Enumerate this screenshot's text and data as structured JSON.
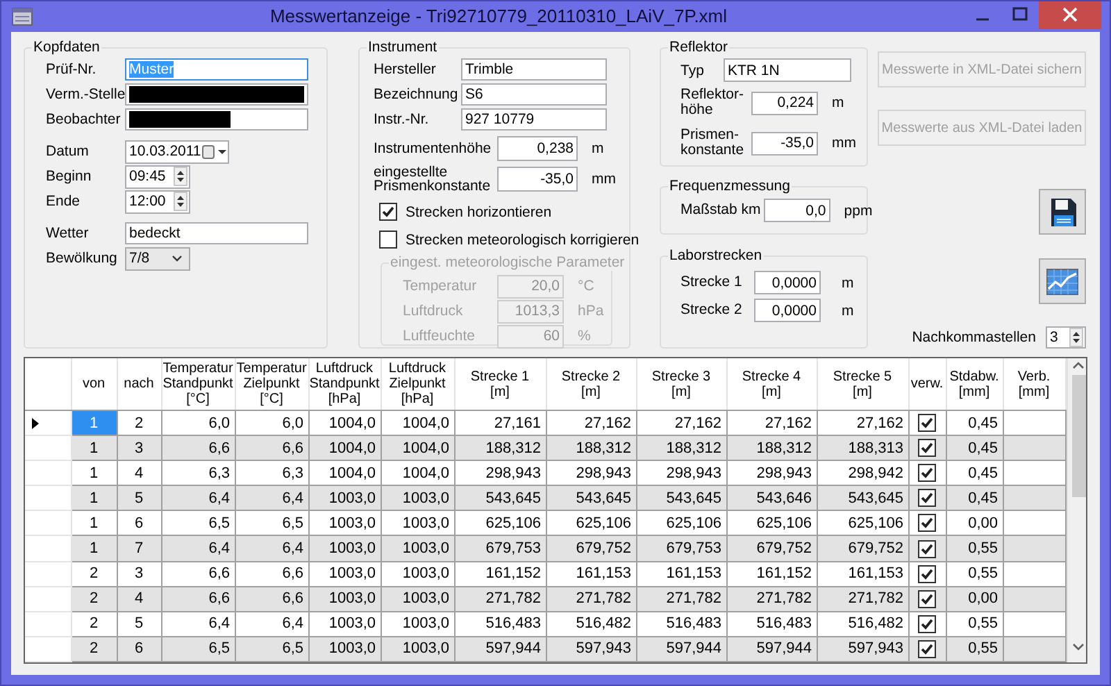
{
  "window": {
    "title": "Messwertanzeige - Tri92710779_20110310_LAiV_7P.xml"
  },
  "kopfdaten": {
    "title": "Kopfdaten",
    "sections": [
      {
        "fields": [
          {
            "label": "Prüf-Nr.",
            "kind": "text",
            "value": "Muster",
            "selected": true
          },
          {
            "label": "Verm.-Stelle",
            "kind": "redacted_full"
          },
          {
            "label": "Beobachter",
            "kind": "redacted_partial"
          }
        ]
      },
      {
        "fields": [
          {
            "label": "Datum",
            "kind": "date",
            "value": "10.03.2011"
          },
          {
            "label": "Beginn",
            "kind": "time",
            "value": "09:45"
          },
          {
            "label": "Ende",
            "kind": "time",
            "value": "12:00"
          }
        ]
      },
      {
        "fields": [
          {
            "label": "Wetter",
            "kind": "text",
            "value": "bedeckt",
            "selected": false
          },
          {
            "label": "Bewölkung",
            "kind": "combo",
            "value": "7/8"
          }
        ]
      }
    ]
  },
  "instrument": {
    "title": "Instrument",
    "fields": [
      {
        "label": "Hersteller",
        "value": "Trimble"
      },
      {
        "label": "Bezeichnung",
        "value": "S6"
      },
      {
        "label": "Instr.-Nr.",
        "value": "927 10779"
      }
    ],
    "numbers": [
      {
        "label": "Instrumentenhöhe",
        "value": "0,238",
        "unit": "m"
      },
      {
        "label": "eingestellte Prismenkonstante",
        "value": "-35,0",
        "unit": "mm"
      }
    ],
    "checkboxes": [
      {
        "label": "Strecken horizontieren",
        "checked": true
      },
      {
        "label": "Strecken meteorologisch korrigieren",
        "checked": false
      }
    ],
    "meteo": {
      "title": "eingest. meteorologische Parameter",
      "disabled": true,
      "fields": [
        {
          "label": "Temperatur",
          "value": "20,0",
          "unit": "°C"
        },
        {
          "label": "Luftdruck",
          "value": "1013,3",
          "unit": "hPa"
        },
        {
          "label": "Luftfeuchte",
          "value": "60",
          "unit": "%"
        }
      ]
    }
  },
  "reflektor": {
    "title": "Reflektor",
    "type_label": "Typ",
    "type_value": "KTR 1N",
    "numbers": [
      {
        "label": "Reflektor-höhe",
        "value": "0,224",
        "unit": "m"
      },
      {
        "label": "Prismen-konstante",
        "value": "-35,0",
        "unit": "mm"
      }
    ]
  },
  "frequenzmessung": {
    "title": "Frequenzmessung",
    "fields": [
      {
        "label": "Maßstab km",
        "value": "0,0",
        "unit": "ppm"
      }
    ]
  },
  "laborstrecken": {
    "title": "Laborstrecken",
    "fields": [
      {
        "label": "Strecke 1",
        "value": "0,0000",
        "unit": "m"
      },
      {
        "label": "Strecke 2",
        "value": "0,0000",
        "unit": "m"
      }
    ]
  },
  "buttons": [
    {
      "label": "Messwerte in XML-Datei sichern",
      "disabled": true
    },
    {
      "label": "Messwerte aus XML-Datei laden",
      "disabled": true
    }
  ],
  "icon_buttons": [
    {
      "kind": "save"
    },
    {
      "kind": "chart"
    }
  ],
  "nachkommastellen": {
    "label": "Nachkommastellen",
    "value": "3"
  },
  "table": {
    "columns": [
      "von",
      "nach",
      "Temperatur\nStandpunkt\n[°C]",
      "Temperatur\nZielpunkt\n[°C]",
      "Luftdruck\nStandpunkt\n[hPa]",
      "Luftdruck\nZielpunkt\n[hPa]",
      "Strecke 1\n[m]",
      "Strecke 2\n[m]",
      "Strecke 3\n[m]",
      "Strecke 4\n[m]",
      "Strecke 5\n[m]",
      "verw.",
      "Stdabw.\n[mm]",
      "Verb.\n[mm]"
    ],
    "rows": [
      {
        "values": [
          "1",
          "2",
          "6,0",
          "6,0",
          "1004,0",
          "1004,0",
          "27,161",
          "27,162",
          "27,162",
          "27,162",
          "27,162"
        ],
        "verw": true,
        "stdabw": "0,45",
        "selected": true
      },
      {
        "values": [
          "1",
          "3",
          "6,6",
          "6,6",
          "1004,0",
          "1004,0",
          "188,312",
          "188,312",
          "188,312",
          "188,312",
          "188,313"
        ],
        "verw": true,
        "stdabw": "0,45",
        "selected": false
      },
      {
        "values": [
          "1",
          "4",
          "6,3",
          "6,3",
          "1004,0",
          "1004,0",
          "298,943",
          "298,943",
          "298,943",
          "298,943",
          "298,942"
        ],
        "verw": true,
        "stdabw": "0,45",
        "selected": false
      },
      {
        "values": [
          "1",
          "5",
          "6,4",
          "6,4",
          "1003,0",
          "1003,0",
          "543,645",
          "543,645",
          "543,645",
          "543,646",
          "543,645"
        ],
        "verw": true,
        "stdabw": "0,45",
        "selected": false
      },
      {
        "values": [
          "1",
          "6",
          "6,5",
          "6,5",
          "1003,0",
          "1003,0",
          "625,106",
          "625,106",
          "625,106",
          "625,106",
          "625,106"
        ],
        "verw": true,
        "stdabw": "0,00",
        "selected": false
      },
      {
        "values": [
          "1",
          "7",
          "6,4",
          "6,4",
          "1003,0",
          "1003,0",
          "679,753",
          "679,752",
          "679,753",
          "679,752",
          "679,752"
        ],
        "verw": true,
        "stdabw": "0,55",
        "selected": false
      },
      {
        "values": [
          "2",
          "3",
          "6,6",
          "6,6",
          "1003,0",
          "1003,0",
          "161,152",
          "161,153",
          "161,153",
          "161,152",
          "161,153"
        ],
        "verw": true,
        "stdabw": "0,55",
        "selected": false
      },
      {
        "values": [
          "2",
          "4",
          "6,6",
          "6,6",
          "1003,0",
          "1003,0",
          "271,782",
          "271,782",
          "271,782",
          "271,782",
          "271,782"
        ],
        "verw": true,
        "stdabw": "0,00",
        "selected": false
      },
      {
        "values": [
          "2",
          "5",
          "6,4",
          "6,4",
          "1003,0",
          "1003,0",
          "516,483",
          "516,482",
          "516,483",
          "516,483",
          "516,482"
        ],
        "verw": true,
        "stdabw": "0,55",
        "selected": false
      },
      {
        "values": [
          "2",
          "6",
          "6,5",
          "6,5",
          "1003,0",
          "1003,0",
          "597,944",
          "597,943",
          "597,944",
          "597,944",
          "597,943"
        ],
        "verw": true,
        "stdabw": "0,55",
        "selected": false
      }
    ]
  }
}
